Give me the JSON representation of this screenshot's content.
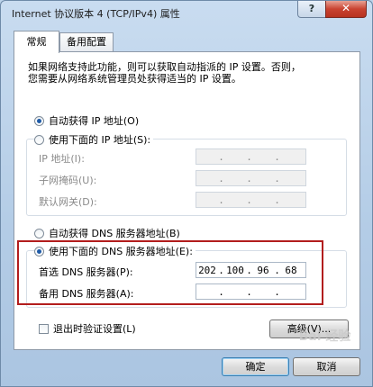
{
  "window": {
    "title": "Internet 协议版本 4 (TCP/IPv4) 属性",
    "help_label": "?",
    "close_label": "✕"
  },
  "tabs": [
    {
      "label": "常规",
      "active": true
    },
    {
      "label": "备用配置",
      "active": false
    }
  ],
  "description": "如果网络支持此功能，则可以获取自动指派的 IP 设置。否则，\n您需要从网络系统管理员处获得适当的 IP 设置。",
  "ip_section": {
    "auto_label": "自动获得 IP 地址(O)",
    "manual_label": "使用下面的 IP 地址(S):",
    "selected": "auto",
    "fields": [
      {
        "label": "IP 地址(I):",
        "octets": [
          "",
          "",
          "",
          ""
        ]
      },
      {
        "label": "子网掩码(U):",
        "octets": [
          "",
          "",
          "",
          ""
        ]
      },
      {
        "label": "默认网关(D):",
        "octets": [
          "",
          "",
          "",
          ""
        ]
      }
    ]
  },
  "dns_section": {
    "auto_label": "自动获得 DNS 服务器地址(B)",
    "manual_label": "使用下面的 DNS 服务器地址(E):",
    "selected": "manual",
    "fields": [
      {
        "label": "首选 DNS 服务器(P):",
        "octets": [
          "202",
          "100",
          "96",
          "68"
        ]
      },
      {
        "label": "备用 DNS 服务器(A):",
        "octets": [
          "",
          "",
          "",
          ""
        ]
      }
    ]
  },
  "validate_label": "退出时验证设置(L)",
  "advanced_label": "高级(V)...",
  "ok_label": "确定",
  "cancel_label": "取消",
  "watermark_text": "Bai 经验"
}
